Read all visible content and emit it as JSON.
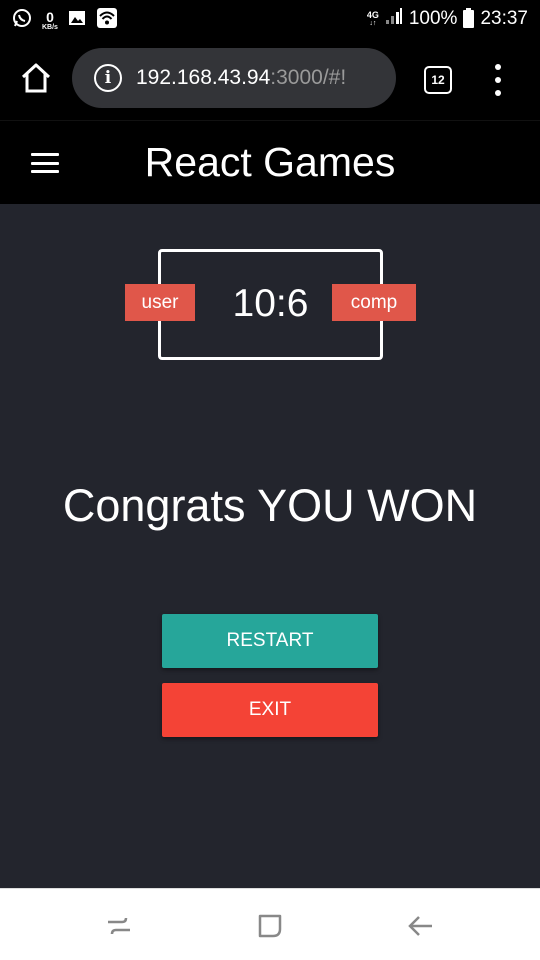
{
  "status_bar": {
    "speed_value": "0",
    "speed_unit": "KB/s",
    "network": "4G",
    "battery": "100%",
    "time": "23:37"
  },
  "browser": {
    "url_host": "192.168.43.94",
    "url_rest": ":3000/#!",
    "tab_count": "12"
  },
  "app": {
    "title": "React Games"
  },
  "game": {
    "user_label": "user",
    "comp_label": "comp",
    "score": "10:6",
    "result": "Congrats YOU WON",
    "restart_label": "RESTART",
    "exit_label": "EXIT"
  },
  "colors": {
    "background": "#23252d",
    "tag": "#e0574a",
    "restart": "#26a69a",
    "exit": "#f44336"
  }
}
